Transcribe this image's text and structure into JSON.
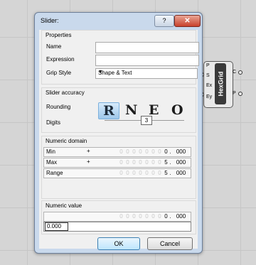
{
  "dialog": {
    "title": "Slider:",
    "help_label": "?",
    "close_label": "✕"
  },
  "properties": {
    "group_title": "Properties",
    "name_label": "Name",
    "name_value": "",
    "expression_label": "Expression",
    "expression_value": "",
    "grip_style_label": "Grip Style",
    "grip_style_value": "Shape & Text"
  },
  "accuracy": {
    "group_title": "Slider accuracy",
    "rounding_label": "Rounding",
    "rounding_options": [
      "R",
      "N",
      "E",
      "O"
    ],
    "rounding_selected": "R",
    "digits_label": "Digits",
    "digits_value": "3"
  },
  "domain": {
    "group_title": "Numeric domain",
    "rows": [
      {
        "label": "Min",
        "sign": "+",
        "int": "0",
        "dec": "000"
      },
      {
        "label": "Max",
        "sign": "+",
        "int": "5",
        "dec": "000"
      },
      {
        "label": "Range",
        "sign": "",
        "int": "5",
        "dec": "000"
      }
    ]
  },
  "numeric_value": {
    "group_title": "Numeric value",
    "int": "0",
    "dec": "000",
    "slider_value": "0.000"
  },
  "buttons": {
    "ok": "OK",
    "cancel": "Cancel"
  },
  "component": {
    "name": "HexGrid",
    "inputs": [
      "P",
      "S",
      "Ex",
      "Ey"
    ],
    "outputs": [
      "C",
      "P"
    ]
  }
}
